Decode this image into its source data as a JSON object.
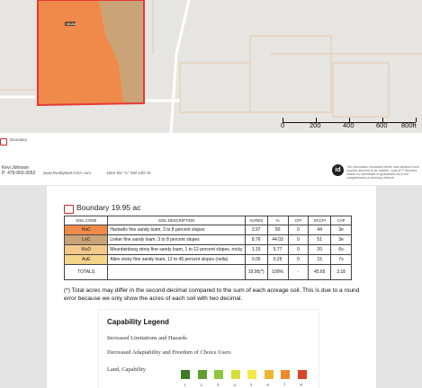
{
  "map": {
    "parcel_label": "McAd",
    "road_label": "",
    "scale_labels": [
      "0",
      "200",
      "400",
      "600",
      "800ft"
    ],
    "colors": {
      "parcel_fill": "#f08a4b",
      "parcel_border": "#e53935",
      "soil_tan": "#c9a477",
      "background": "#e6e5e2"
    }
  },
  "boundary_strip": {
    "label": "Boundary"
  },
  "footer": {
    "agent_name": "Kevi Johnson",
    "agent_phone": "P: 479-903-3052",
    "website": "www.RealtyMart-USA.com",
    "address": "1504 Ste \"A\" SW 14th St.",
    "logo_text": "id",
    "disclaimer": "The information contained herein was obtained from sources deemed to be reliable. Land id™ Services makes no warranties or guarantees as to the completeness or accuracy thereof."
  },
  "document": {
    "title": "Boundary 19.95 ac",
    "table": {
      "headers": [
        "SOIL CODE",
        "SOIL DESCRIPTION",
        "ACRES",
        "%",
        "CPI",
        "NCCPI",
        "CAP"
      ],
      "rows": [
        {
          "code": "HaC",
          "color": "#f08a4b",
          "desc": "Hartsells fine sandy loam, 3 to 8 percent slopes",
          "acres": "3.97",
          "pct": "50",
          "cpi": "0",
          "nccpi": "44",
          "cap": "3e"
        },
        {
          "code": "LnC",
          "color": "#c9a477",
          "desc": "Linker fine sandy loam, 3 to 8 percent slopes",
          "acres": "8.76",
          "pct": "44.03",
          "cpi": "0",
          "nccpi": "51",
          "cap": "3e"
        },
        {
          "code": "MuD",
          "color": "#f5c98a",
          "desc": "Mountainburg stony fine sandy loam, 1 to 12 percent slopes, rocky",
          "acres": "1.15",
          "pct": "5.77",
          "cpi": "0",
          "nccpi": "20",
          "cap": "6s"
        },
        {
          "code": "AuE",
          "color": "#f5d58a",
          "desc": "Allen stony fine sandy loam, 12 to 45 percent slopes (nella)",
          "acres": "0.05",
          "pct": "0.25",
          "cpi": "0",
          "nccpi": "15",
          "cap": "7s"
        }
      ],
      "totals": {
        "code": "TOTALS",
        "desc": "",
        "acres": "19.95(*)",
        "pct": "100%",
        "cpi": "-",
        "nccpi": "45.65",
        "cap": "3.18"
      }
    },
    "note": "(*) Total acres may differ in the second decimal compared to the sum of each acreage soil. This is due to a round error because we only show the acres of each soil with two decimal.",
    "legend": {
      "title": "Capability Legend",
      "line1": "Increased Limitations and Hazards",
      "line2": "Decreased Adaptability and Freedom of Choice Users",
      "line3": "Land, Capability",
      "swatches": [
        {
          "num": "1",
          "color": "#3d7a23"
        },
        {
          "num": "2",
          "color": "#5f9e2f"
        },
        {
          "num": "3",
          "color": "#8ec63f"
        },
        {
          "num": "4",
          "color": "#d6e03b"
        },
        {
          "num": "5",
          "color": "#f2e84a"
        },
        {
          "num": "6",
          "color": "#f0b433"
        },
        {
          "num": "7",
          "color": "#e98a2c"
        },
        {
          "num": "8",
          "color": "#d8442a"
        }
      ]
    }
  }
}
